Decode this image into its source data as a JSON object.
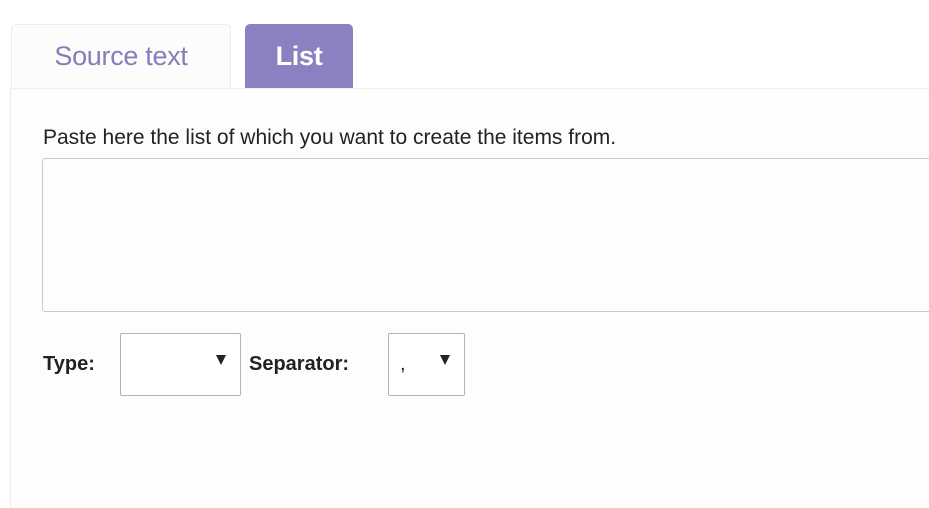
{
  "tabs": [
    {
      "label": "Source text",
      "active": false
    },
    {
      "label": "List",
      "active": true
    }
  ],
  "colors": {
    "accent": "#8d80c0",
    "inactive_tab_text": "#8a7bbd"
  },
  "list_panel": {
    "instructions": "Paste here the list of which you want to create the items from.",
    "list_value": "",
    "type_label": "Type:",
    "type_value": "",
    "separator_label": "Separator:",
    "separator_value": ","
  },
  "icons": {
    "dropdown": "chevron-down-icon"
  }
}
